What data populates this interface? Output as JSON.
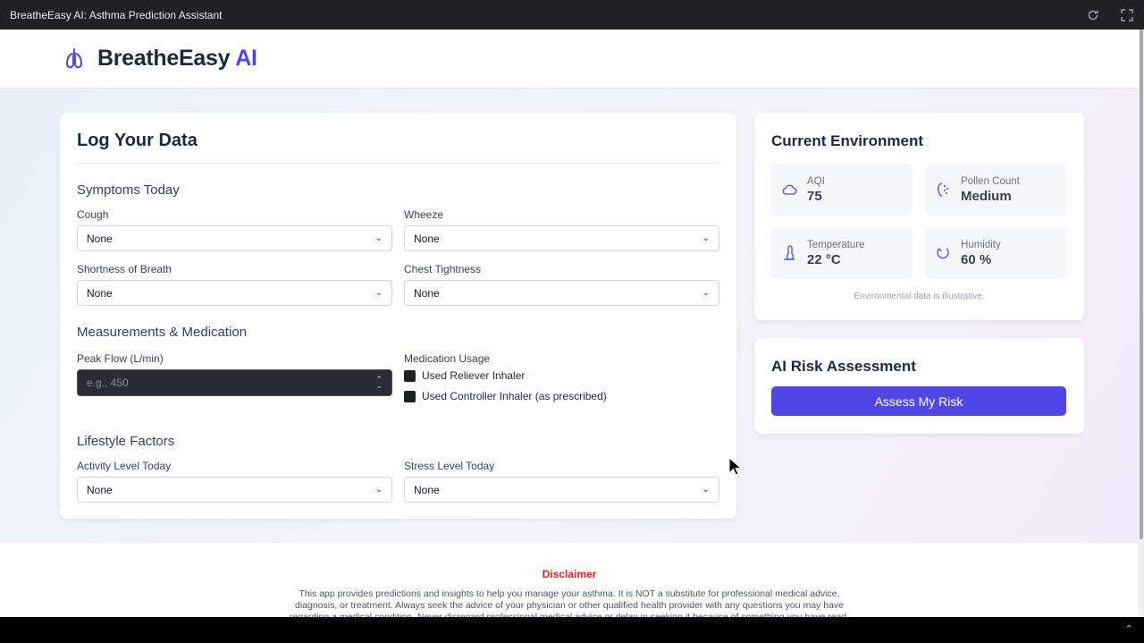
{
  "window": {
    "title": "BreatheEasy AI: Asthma Prediction Assistant"
  },
  "header": {
    "brand_main": "BreatheEasy",
    "brand_accent": "AI"
  },
  "log": {
    "title": "Log Your Data",
    "symptoms": {
      "title": "Symptoms Today",
      "cough": {
        "label": "Cough",
        "value": "None"
      },
      "wheeze": {
        "label": "Wheeze",
        "value": "None"
      },
      "sob": {
        "label": "Shortness of Breath",
        "value": "None"
      },
      "chest": {
        "label": "Chest Tightness",
        "value": "None"
      }
    },
    "measurements": {
      "title": "Measurements & Medication",
      "peak_flow": {
        "label": "Peak Flow (L/min)",
        "placeholder": "e.g., 450"
      },
      "medication": {
        "label": "Medication Usage",
        "reliever": "Used Reliever Inhaler",
        "controller": "Used Controller Inhaler (as prescribed)"
      }
    },
    "lifestyle": {
      "title": "Lifestyle Factors",
      "activity": {
        "label": "Activity Level Today",
        "value": "None"
      },
      "stress": {
        "label": "Stress Level Today",
        "value": "None"
      }
    }
  },
  "environment": {
    "title": "Current Environment",
    "aqi": {
      "label": "AQI",
      "value": "75",
      "icon": "cloud-icon"
    },
    "pollen": {
      "label": "Pollen Count",
      "value": "Medium",
      "icon": "pollen-icon"
    },
    "temperature": {
      "label": "Temperature",
      "value": "22 °C",
      "icon": "thermometer-icon"
    },
    "humidity": {
      "label": "Humidity",
      "value": "60 %",
      "icon": "droplet-icon"
    },
    "note": "Environmental data is illustrative."
  },
  "ai": {
    "title": "AI Risk Assessment",
    "button": "Assess My Risk"
  },
  "footer": {
    "disclaimer_title": "Disclaimer",
    "disclaimer_text": "This app provides predictions and insights to help you manage your asthma. It is NOT a substitute for professional medical advice, diagnosis, or treatment. Always seek the advice of your physician or other qualified health provider with any questions you may have regarding a medical condition. Never disregard professional medical advice or delay in seeking it because of something you have read."
  },
  "colors": {
    "accent": "#4f46e5",
    "disclaimer": "#dc2626",
    "titlebar": "#202124"
  }
}
